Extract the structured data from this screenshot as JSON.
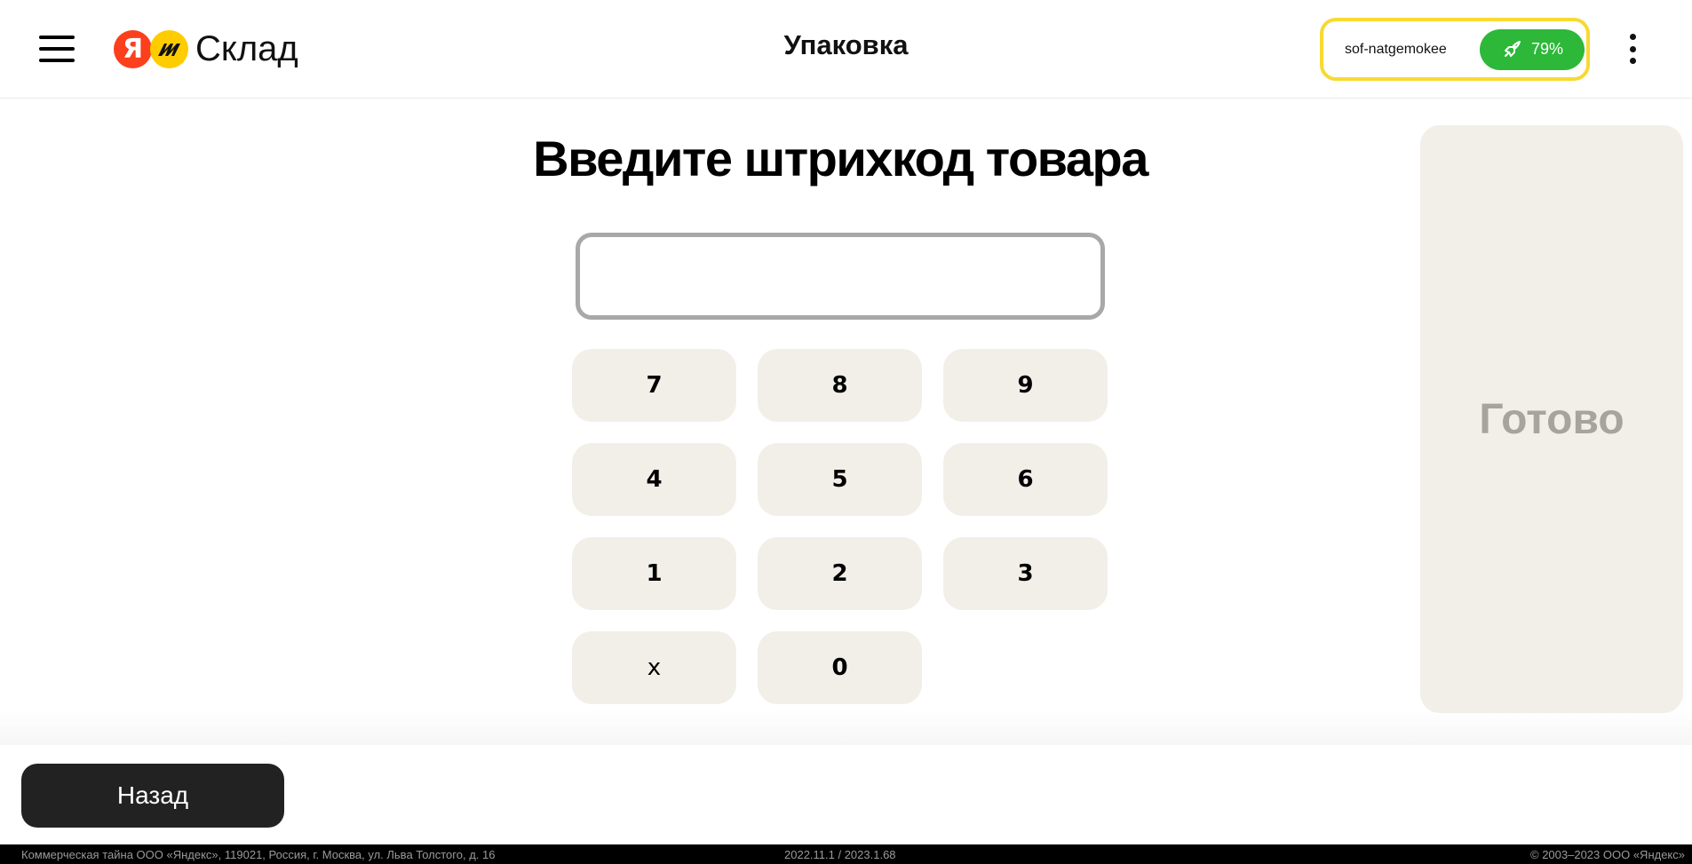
{
  "header": {
    "logo_text": "Склад",
    "logo_ya": "Я",
    "title": "Упаковка",
    "user_name": "sof-natgemokee",
    "progress": "79%"
  },
  "main": {
    "prompt": "Введите штрихкод товара",
    "barcode_value": "",
    "keys": [
      "7",
      "8",
      "9",
      "4",
      "5",
      "6",
      "1",
      "2",
      "3",
      "x",
      "0"
    ],
    "done_label": "Готово"
  },
  "bottom": {
    "back_label": "Назад"
  },
  "footer": {
    "legal": "Коммерческая тайна ООО «Яндекс», 119021, Россия, г. Москва, ул. Льва Толстого, д. 16",
    "version": "2022.11.1 / 2023.1.68",
    "copyright": "© 2003–2023 ООО «Яндекс»"
  },
  "colors": {
    "accent_yellow": "#f8d932",
    "progress_green": "#2db839",
    "key_bg": "#f2efe9",
    "back_button_bg": "#222222"
  },
  "icons": [
    "menu-icon",
    "rocket-icon",
    "more-vertical-icon"
  ]
}
